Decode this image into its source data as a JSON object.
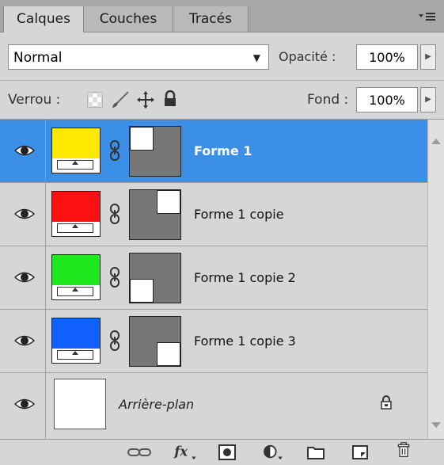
{
  "tabs": [
    {
      "label": "Calques",
      "active": true
    },
    {
      "label": "Couches",
      "active": false
    },
    {
      "label": "Tracés",
      "active": false
    }
  ],
  "panel_menu_icon": "panel-menu-icon",
  "blend_mode": "Normal",
  "opacity": {
    "label": "Opacité :",
    "value": "100%"
  },
  "lock": {
    "label": "Verrou :",
    "icons": [
      "lock-transparency-icon",
      "lock-paint-icon",
      "lock-move-icon",
      "lock-all-icon"
    ]
  },
  "fill": {
    "label": "Fond :",
    "value": "100%"
  },
  "layers": [
    {
      "name": "Forme 1",
      "color": "#ffe800",
      "mask_corner": "top-left",
      "selected": true,
      "visible": true
    },
    {
      "name": "Forme 1 copie",
      "color": "#ff1010",
      "mask_corner": "top-right",
      "selected": false,
      "visible": true
    },
    {
      "name": "Forme 1 copie 2",
      "color": "#1ee81e",
      "mask_corner": "bottom-left",
      "selected": false,
      "visible": true
    },
    {
      "name": "Forme 1 copie 3",
      "color": "#1060ff",
      "mask_corner": "bottom-right",
      "selected": false,
      "visible": true
    }
  ],
  "background_layer": {
    "name": "Arrière-plan",
    "locked": true,
    "visible": true
  },
  "bottom_toolbar": [
    "link-layers-icon",
    "fx-icon",
    "add-mask-icon",
    "adjustment-layer-icon",
    "new-group-icon",
    "new-layer-icon",
    "trash-icon"
  ],
  "colors": {
    "selection": "#3b8fe6",
    "panel": "#d6d6d6",
    "tabbar": "#a8a8a8"
  }
}
